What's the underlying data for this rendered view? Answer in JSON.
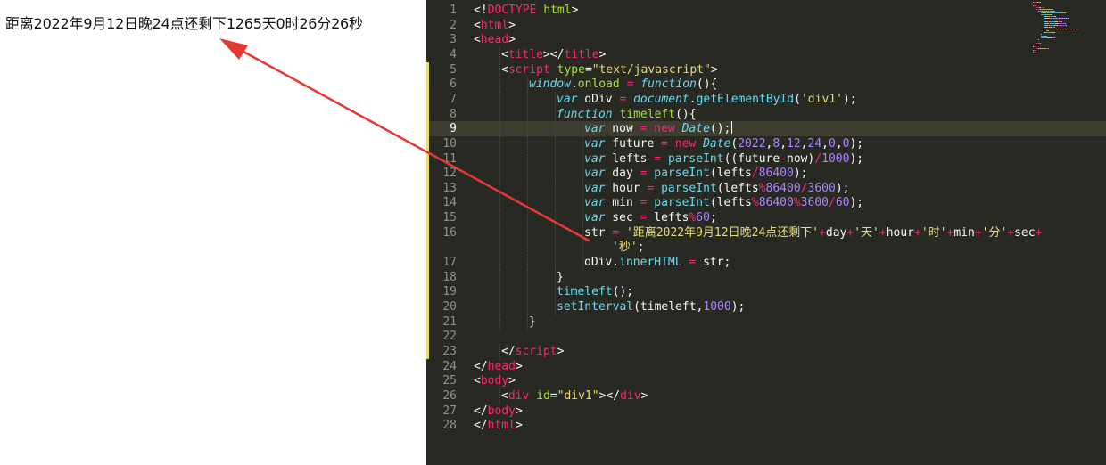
{
  "browser": {
    "countdown_text": "距离2022年9月12日晚24点还剩下1265天0时26分26秒"
  },
  "editor": {
    "active_line": 9,
    "modified_lines": [
      5,
      23
    ],
    "lines": [
      {
        "num": "1",
        "indent": 0,
        "tokens": [
          [
            "p",
            "<!"
          ],
          [
            "t",
            "DOCTYPE"
          ],
          [
            "p",
            " "
          ],
          [
            "a",
            "html"
          ],
          [
            "p",
            ">"
          ]
        ]
      },
      {
        "num": "2",
        "indent": 0,
        "tokens": [
          [
            "p",
            "<"
          ],
          [
            "t",
            "html"
          ],
          [
            "p",
            ">"
          ]
        ]
      },
      {
        "num": "3",
        "indent": 0,
        "tokens": [
          [
            "p",
            "<"
          ],
          [
            "t",
            "head"
          ],
          [
            "p",
            ">"
          ]
        ]
      },
      {
        "num": "4",
        "indent": 1,
        "tokens": [
          [
            "p",
            "<"
          ],
          [
            "t",
            "title"
          ],
          [
            "p",
            "></"
          ],
          [
            "t",
            "title"
          ],
          [
            "p",
            ">"
          ]
        ]
      },
      {
        "num": "5",
        "indent": 1,
        "tokens": [
          [
            "p",
            "<"
          ],
          [
            "t",
            "script"
          ],
          [
            "p",
            " "
          ],
          [
            "a",
            "type"
          ],
          [
            "p",
            "="
          ],
          [
            "s",
            "\"text/javascript\""
          ],
          [
            "p",
            ">"
          ]
        ]
      },
      {
        "num": "6",
        "indent": 2,
        "tokens": [
          [
            "k",
            "window"
          ],
          [
            "p",
            "."
          ],
          [
            "f",
            "onload"
          ],
          [
            "p",
            " "
          ],
          [
            "o",
            "="
          ],
          [
            "p",
            " "
          ],
          [
            "k",
            "function"
          ],
          [
            "p",
            "(){"
          ]
        ]
      },
      {
        "num": "7",
        "indent": 3,
        "tokens": [
          [
            "k",
            "var"
          ],
          [
            "p",
            " oDiv "
          ],
          [
            "o",
            "="
          ],
          [
            "p",
            " "
          ],
          [
            "k",
            "document"
          ],
          [
            "p",
            "."
          ],
          [
            "c",
            "getElementById"
          ],
          [
            "p",
            "("
          ],
          [
            "s",
            "'div1'"
          ],
          [
            "p",
            ");"
          ]
        ]
      },
      {
        "num": "8",
        "indent": 3,
        "tokens": [
          [
            "k",
            "function"
          ],
          [
            "p",
            " "
          ],
          [
            "f",
            "timeleft"
          ],
          [
            "p",
            "(){"
          ]
        ]
      },
      {
        "num": "9",
        "indent": 4,
        "cursor": true,
        "tokens": [
          [
            "k",
            "var"
          ],
          [
            "p",
            " now "
          ],
          [
            "o",
            "="
          ],
          [
            "p",
            " "
          ],
          [
            "o",
            "new"
          ],
          [
            "p",
            " "
          ],
          [
            "k",
            "Date"
          ],
          [
            "p",
            "();"
          ]
        ]
      },
      {
        "num": "10",
        "indent": 4,
        "tokens": [
          [
            "k",
            "var"
          ],
          [
            "p",
            " future "
          ],
          [
            "o",
            "="
          ],
          [
            "p",
            " "
          ],
          [
            "o",
            "new"
          ],
          [
            "p",
            " "
          ],
          [
            "k",
            "Date"
          ],
          [
            "p",
            "("
          ],
          [
            "n",
            "2022"
          ],
          [
            "p",
            ","
          ],
          [
            "n",
            "8"
          ],
          [
            "p",
            ","
          ],
          [
            "n",
            "12"
          ],
          [
            "p",
            ","
          ],
          [
            "n",
            "24"
          ],
          [
            "p",
            ","
          ],
          [
            "n",
            "0"
          ],
          [
            "p",
            ","
          ],
          [
            "n",
            "0"
          ],
          [
            "p",
            ");"
          ]
        ]
      },
      {
        "num": "11",
        "indent": 4,
        "tokens": [
          [
            "k",
            "var"
          ],
          [
            "p",
            " lefts "
          ],
          [
            "o",
            "="
          ],
          [
            "p",
            " "
          ],
          [
            "c",
            "parseInt"
          ],
          [
            "p",
            "((future"
          ],
          [
            "o",
            "-"
          ],
          [
            "p",
            "now)"
          ],
          [
            "o",
            "/"
          ],
          [
            "n",
            "1000"
          ],
          [
            "p",
            ");"
          ]
        ]
      },
      {
        "num": "12",
        "indent": 4,
        "tokens": [
          [
            "k",
            "var"
          ],
          [
            "p",
            " day "
          ],
          [
            "o",
            "="
          ],
          [
            "p",
            " "
          ],
          [
            "c",
            "parseInt"
          ],
          [
            "p",
            "(lefts"
          ],
          [
            "o",
            "/"
          ],
          [
            "n",
            "86400"
          ],
          [
            "p",
            ");"
          ]
        ]
      },
      {
        "num": "13",
        "indent": 4,
        "tokens": [
          [
            "k",
            "var"
          ],
          [
            "p",
            " hour "
          ],
          [
            "o",
            "="
          ],
          [
            "p",
            " "
          ],
          [
            "c",
            "parseInt"
          ],
          [
            "p",
            "(lefts"
          ],
          [
            "o",
            "%"
          ],
          [
            "n",
            "86400"
          ],
          [
            "o",
            "/"
          ],
          [
            "n",
            "3600"
          ],
          [
            "p",
            ");"
          ]
        ]
      },
      {
        "num": "14",
        "indent": 4,
        "tokens": [
          [
            "k",
            "var"
          ],
          [
            "p",
            " min "
          ],
          [
            "o",
            "="
          ],
          [
            "p",
            " "
          ],
          [
            "c",
            "parseInt"
          ],
          [
            "p",
            "(lefts"
          ],
          [
            "o",
            "%"
          ],
          [
            "n",
            "86400"
          ],
          [
            "o",
            "%"
          ],
          [
            "n",
            "3600"
          ],
          [
            "o",
            "/"
          ],
          [
            "n",
            "60"
          ],
          [
            "p",
            ");"
          ]
        ]
      },
      {
        "num": "15",
        "indent": 4,
        "tokens": [
          [
            "k",
            "var"
          ],
          [
            "p",
            " sec "
          ],
          [
            "o",
            "="
          ],
          [
            "p",
            " lefts"
          ],
          [
            "o",
            "%"
          ],
          [
            "n",
            "60"
          ],
          [
            "p",
            ";"
          ]
        ]
      },
      {
        "num": "16",
        "indent": 4,
        "tokens": [
          [
            "p",
            "str "
          ],
          [
            "o",
            "="
          ],
          [
            "p",
            " "
          ],
          [
            "s",
            "'距离2022年9月12日晚24点还剩下'"
          ],
          [
            "o",
            "+"
          ],
          [
            "p",
            "day"
          ],
          [
            "o",
            "+"
          ],
          [
            "s",
            "'天'"
          ],
          [
            "o",
            "+"
          ],
          [
            "p",
            "hour"
          ],
          [
            "o",
            "+"
          ],
          [
            "s",
            "'时'"
          ],
          [
            "o",
            "+"
          ],
          [
            "p",
            "min"
          ],
          [
            "o",
            "+"
          ],
          [
            "s",
            "'分'"
          ],
          [
            "o",
            "+"
          ],
          [
            "p",
            "sec"
          ],
          [
            "o",
            "+"
          ]
        ]
      },
      {
        "num": "",
        "indent": 5,
        "tokens": [
          [
            "s",
            "'秒'"
          ],
          [
            "p",
            ";"
          ]
        ]
      },
      {
        "num": "17",
        "indent": 4,
        "tokens": [
          [
            "p",
            "oDiv."
          ],
          [
            "c",
            "innerHTML"
          ],
          [
            "p",
            " "
          ],
          [
            "o",
            "="
          ],
          [
            "p",
            " str;"
          ]
        ]
      },
      {
        "num": "18",
        "indent": 3,
        "tokens": [
          [
            "p",
            "}"
          ]
        ]
      },
      {
        "num": "19",
        "indent": 3,
        "tokens": [
          [
            "c",
            "timeleft"
          ],
          [
            "p",
            "();"
          ]
        ]
      },
      {
        "num": "20",
        "indent": 3,
        "tokens": [
          [
            "c",
            "setInterval"
          ],
          [
            "p",
            "(timeleft,"
          ],
          [
            "n",
            "1000"
          ],
          [
            "p",
            ");"
          ]
        ]
      },
      {
        "num": "21",
        "indent": 2,
        "tokens": [
          [
            "p",
            "}"
          ]
        ]
      },
      {
        "num": "22",
        "indent": 0,
        "tokens": []
      },
      {
        "num": "23",
        "indent": 1,
        "tokens": [
          [
            "p",
            "</"
          ],
          [
            "t",
            "script"
          ],
          [
            "p",
            ">"
          ]
        ]
      },
      {
        "num": "24",
        "indent": 0,
        "tokens": [
          [
            "p",
            "</"
          ],
          [
            "t",
            "head"
          ],
          [
            "p",
            ">"
          ]
        ]
      },
      {
        "num": "25",
        "indent": 0,
        "tokens": [
          [
            "p",
            "<"
          ],
          [
            "t",
            "body"
          ],
          [
            "p",
            ">"
          ]
        ]
      },
      {
        "num": "26",
        "indent": 1,
        "tokens": [
          [
            "p",
            "<"
          ],
          [
            "t",
            "div"
          ],
          [
            "p",
            " "
          ],
          [
            "a",
            "id"
          ],
          [
            "p",
            "="
          ],
          [
            "s",
            "\"div1\""
          ],
          [
            "p",
            "></"
          ],
          [
            "t",
            "div"
          ],
          [
            "p",
            ">"
          ]
        ]
      },
      {
        "num": "27",
        "indent": 0,
        "tokens": [
          [
            "p",
            "</"
          ],
          [
            "t",
            "body"
          ],
          [
            "p",
            ">"
          ]
        ]
      },
      {
        "num": "28",
        "indent": 0,
        "tokens": [
          [
            "p",
            "</"
          ],
          [
            "t",
            "html"
          ],
          [
            "p",
            ">"
          ]
        ]
      }
    ]
  },
  "colors": {
    "editor_bg": "#282923",
    "active_line_bg": "#3E3D32",
    "arrow": "#E53935",
    "tag": "#F92672",
    "attribute": "#A6E22E",
    "string": "#E6DB74",
    "keyword": "#66D9EF",
    "number": "#AE81FF"
  }
}
